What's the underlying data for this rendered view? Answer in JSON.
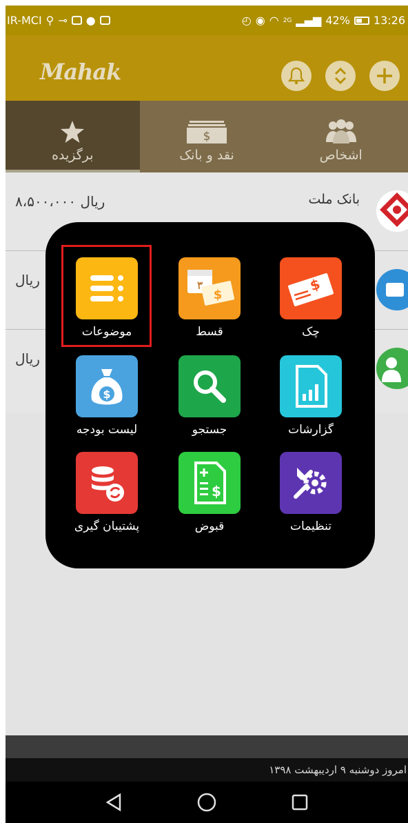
{
  "status_bar": {
    "carrier": "IR-MCI",
    "network": "2G",
    "battery": "42%",
    "time": "13:26"
  },
  "app_bar": {
    "logo": "Mahak"
  },
  "tabs": [
    {
      "label": "برگزیده",
      "icon": "star-icon",
      "active": true
    },
    {
      "label": "نقد و بانک",
      "icon": "cash-icon",
      "active": false
    },
    {
      "label": "اشخاص",
      "icon": "people-icon",
      "active": false
    }
  ],
  "accounts": [
    {
      "name": "بانک ملت",
      "amount": "۸،۵۰۰،۰۰۰ ریال",
      "icon": "bank-mellat-icon"
    },
    {
      "name": "",
      "amount": "ریال",
      "icon": "wallet-icon"
    },
    {
      "name": "",
      "amount": "ریال",
      "icon": "person-icon"
    }
  ],
  "menu": [
    {
      "label": "موضوعات",
      "icon": "topics-list-icon",
      "color": "#fdb713",
      "highlighted": true
    },
    {
      "label": "قسط",
      "icon": "installment-calendar-icon",
      "color": "#f59a1c"
    },
    {
      "label": "چک",
      "icon": "check-icon",
      "color": "#f4511e"
    },
    {
      "label": "لیست بودجه",
      "icon": "money-bag-icon",
      "color": "#4aa3df"
    },
    {
      "label": "جستجو",
      "icon": "search-icon",
      "color": "#1ea64a"
    },
    {
      "label": "گزارشات",
      "icon": "report-chart-icon",
      "color": "#26c6da"
    },
    {
      "label": "پشتیبان گیری",
      "icon": "backup-database-icon",
      "color": "#e53935"
    },
    {
      "label": "قبوض",
      "icon": "bill-icon",
      "color": "#2ecc40"
    },
    {
      "label": "تنظیمات",
      "icon": "settings-tools-icon",
      "color": "#5e35b1"
    }
  ],
  "footer": {
    "date_text": "امروز دوشنبه ۹ اردیبهشت ۱۳۹۸"
  },
  "colors": {
    "accent": "#b8920a",
    "highlight": "#e01c1c"
  }
}
